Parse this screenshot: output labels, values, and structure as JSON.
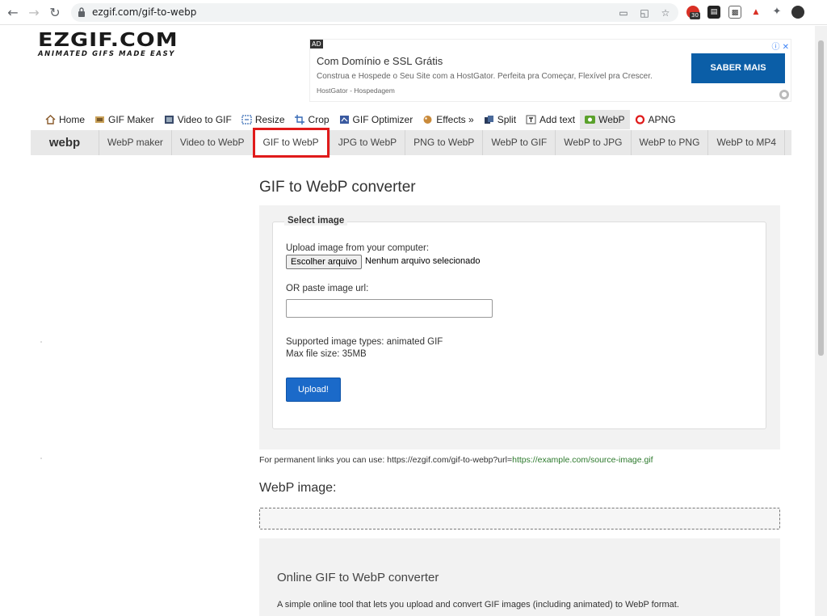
{
  "browser": {
    "url": "ezgif.com/gif-to-webp",
    "ext_badge": "30"
  },
  "logo": {
    "name": "EZGIF.COM",
    "tagline": "ANIMATED GIFS MADE EASY"
  },
  "ad": {
    "tag": "AD",
    "title": "Com Domínio e SSL Grátis",
    "description": "Construa e Hospede o Seu Site com a HostGator. Perfeita pra Começar, Flexível pra Crescer.",
    "host": "HostGator - Hospedagem",
    "cta": "SABER MAIS"
  },
  "main_nav": [
    {
      "label": "Home",
      "icon": "home-icon"
    },
    {
      "label": "GIF Maker",
      "icon": "gif-maker-icon"
    },
    {
      "label": "Video to GIF",
      "icon": "film-icon"
    },
    {
      "label": "Resize",
      "icon": "resize-icon"
    },
    {
      "label": "Crop",
      "icon": "crop-icon"
    },
    {
      "label": "GIF Optimizer",
      "icon": "optimizer-icon"
    },
    {
      "label": "Effects »",
      "icon": "effects-icon"
    },
    {
      "label": "Split",
      "icon": "split-icon"
    },
    {
      "label": "Add text",
      "icon": "text-icon"
    },
    {
      "label": "WebP",
      "icon": "webp-icon"
    },
    {
      "label": "APNG",
      "icon": "apng-icon"
    }
  ],
  "sub_nav": {
    "brand": "webp",
    "tabs": [
      "WebP maker",
      "Video to WebP",
      "GIF to WebP",
      "JPG to WebP",
      "PNG to WebP",
      "WebP to GIF",
      "WebP to JPG",
      "WebP to PNG",
      "WebP to MP4"
    ]
  },
  "form": {
    "heading": "GIF to WebP converter",
    "legend": "Select image",
    "upload_label": "Upload image from your computer:",
    "file_button": "Escolher arquivo",
    "file_status": "Nenhum arquivo selecionado",
    "url_label": "OR paste image url:",
    "url_value": "",
    "supported": "Supported image types: animated GIF",
    "max_size": "Max file size: 35MB",
    "upload_button": "Upload!"
  },
  "permanent": {
    "prefix": "For permanent links you can use: https://ezgif.com/gif-to-webp?url=",
    "example": "https://example.com/source-image.gif"
  },
  "output": {
    "heading": "WebP image:"
  },
  "info": {
    "heading": "Online GIF to WebP converter",
    "text": "A simple online tool that lets you upload and convert GIF images (including animated) to WebP format."
  }
}
